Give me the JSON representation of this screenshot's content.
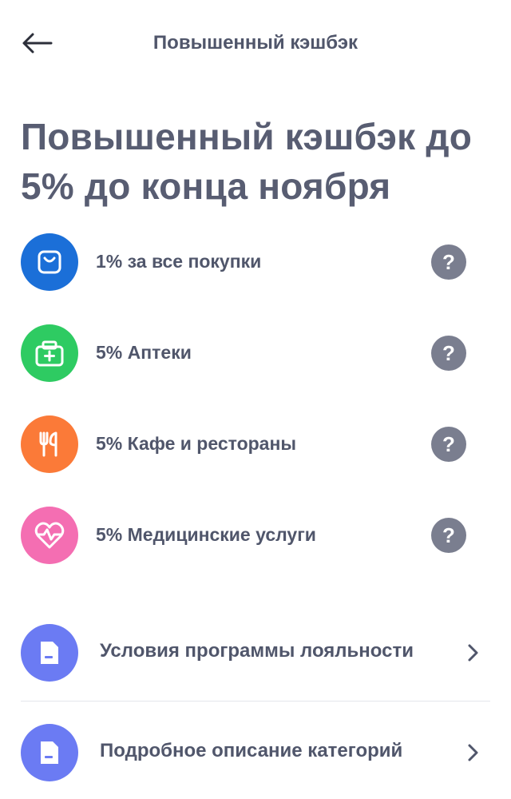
{
  "header": {
    "title": "Повышенный кэшбэк",
    "back_icon": "arrow-left-icon"
  },
  "headline": "Повышенный кэшбэк до 5% до конца ноября",
  "categories": [
    {
      "label": "1% за все покупки",
      "icon": "shopping-bag-icon",
      "color": "#1b6fd8"
    },
    {
      "label": "5% Аптеки",
      "icon": "first-aid-kit-icon",
      "color": "#2ecb62"
    },
    {
      "label": "5% Кафе и рестораны",
      "icon": "fork-spoon-icon",
      "color": "#fb7a38"
    },
    {
      "label": "5% Медицинские услуги",
      "icon": "heart-pulse-icon",
      "color": "#f46eb2"
    }
  ],
  "help_glyph": "?",
  "links": [
    {
      "label": "Условия программы лояльности",
      "icon": "document-icon"
    },
    {
      "label": "Подробное описание категорий",
      "icon": "document-icon"
    }
  ],
  "colors": {
    "text": "#50566b",
    "help": "#7a7e8f",
    "link_icon": "#6b7bf3"
  }
}
